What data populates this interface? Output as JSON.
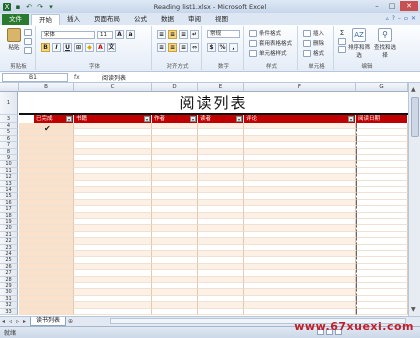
{
  "app": {
    "title": "Reading list1.xlsx - Microsoft Excel"
  },
  "tabs": [
    "文件",
    "开始",
    "插入",
    "页面布局",
    "公式",
    "数据",
    "审阅",
    "视图"
  ],
  "ribbon": {
    "clipboard": {
      "paste": "粘贴",
      "label": "剪贴板"
    },
    "font": {
      "name": "宋体",
      "size": "11",
      "label": "字体"
    },
    "alignment": {
      "label": "对齐方式"
    },
    "number": {
      "format": "常规",
      "percent": "%",
      "label": "数字"
    },
    "styles": {
      "conditional": "条件格式",
      "table": "套用表格格式",
      "cell": "单元格样式",
      "label": "样式"
    },
    "cells": {
      "insert": "插入",
      "delete": "删除",
      "format": "格式",
      "label": "单元格"
    },
    "editing": {
      "sort": "排序和筛选",
      "find": "查找和选择",
      "label": "编辑"
    }
  },
  "formula_bar": {
    "name_box": "B1",
    "fx": "fx",
    "value": "阅读列表"
  },
  "grid": {
    "columns": [
      "A",
      "B",
      "C",
      "D",
      "E",
      "F",
      "G"
    ],
    "title": "阅读列表",
    "headers": [
      "已完成",
      "书籍",
      "作者",
      "读者",
      "评论",
      "阅读日期"
    ]
  },
  "sheet": {
    "tab": "读书列表"
  },
  "status": {
    "text": "就绪"
  },
  "watermark": "www.67xuexi.com"
}
